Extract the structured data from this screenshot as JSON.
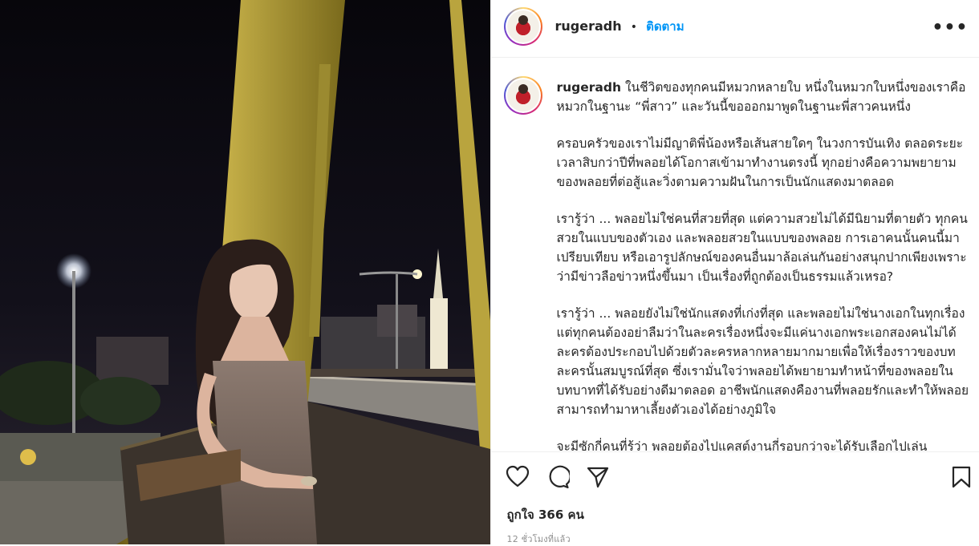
{
  "post": {
    "username": "rugeradh",
    "separator": "•",
    "follow_label": "ติดตาม",
    "more_label": "•••",
    "caption_paragraphs": [
      "ในชีวิตของทุกคนมีหมวกหลายใบ หนึ่งในหมวกใบหนึ่งของเราคือหมวกในฐานะ “พี่สาว” และวันนี้ขอออกมาพูดในฐานะพี่สาวคนหนึ่ง",
      "ครอบครัวของเราไม่มีญาติพี่น้องหรือเส้นสายใดๆ ในวงการบันเทิง ตลอดระยะเวลาสิบกว่าปีที่พลอยได้โอกาสเข้ามาทำงานตรงนี้ ทุกอย่างคือความพยายามของพลอยที่ต่อสู้และวิ่งตามความฝันในการเป็นนักแสดงมาตลอด",
      "เรารู้ว่า ... พลอยไม่ใช่คนที่สวยที่สุด แต่ความสวยไม่ได้มีนิยามที่ตายตัว ทุกคนสวยในแบบของตัวเอง และพลอยสวยในแบบของพลอย การเอาคนนั้นคนนี้มาเปรียบเทียบ หรือเอารูปลักษณ์ของคนอื่นมาล้อเล่นกันอย่างสนุกปากเพียงเพราะว่ามีข่าวลือข่าวหนึ่งขึ้นมา เป็นเรื่องที่ถูกต้องเป็นธรรมแล้วเหรอ?",
      "เรารู้ว่า ... พลอยยังไม่ใช่นักแสดงที่เก่งที่สุด และพลอยไม่ใช่นางเอกในทุกเรื่อง แต่ทุกคนต้องอย่าลืมว่าในละครเรื่องหนึ่งจะมีแค่นางเอกพระเอกสองคนไม่ได้ ละครต้องประกอบไปด้วยตัวละครหลากหลายมากมายเพื่อให้เรื่องราวของบทละครนั้นสมบูรณ์ที่สุด ซึ่งเรามั่นใจว่าพลอยได้พยายามทำหน้าที่ของพลอยในบทบาทที่ได้รับอย่างดีมาตลอด อาชีพนักแสดงคืองานที่พลอยรักและทำให้พลอยสามารถทำมาหาเลี้ยงตัวเองได้อย่างภูมิใจ",
      "จะมีซักกี่คนที่รู้ว่า พลอยต้องไปแคสต์งานกี่รอบกว่าจะได้รับเลือกไปเล่น"
    ],
    "likes_text": "ถูกใจ 366 คน",
    "timestamp": "12 ชั่วโมงที่แล้ว"
  },
  "icons": {
    "like": "heart-icon",
    "comment": "comment-icon",
    "share": "share-icon",
    "save": "bookmark-icon",
    "more": "more-icon"
  },
  "colors": {
    "accent": "#0095f6",
    "text": "#262626",
    "muted": "#8e8e8e",
    "border": "#efefef"
  }
}
